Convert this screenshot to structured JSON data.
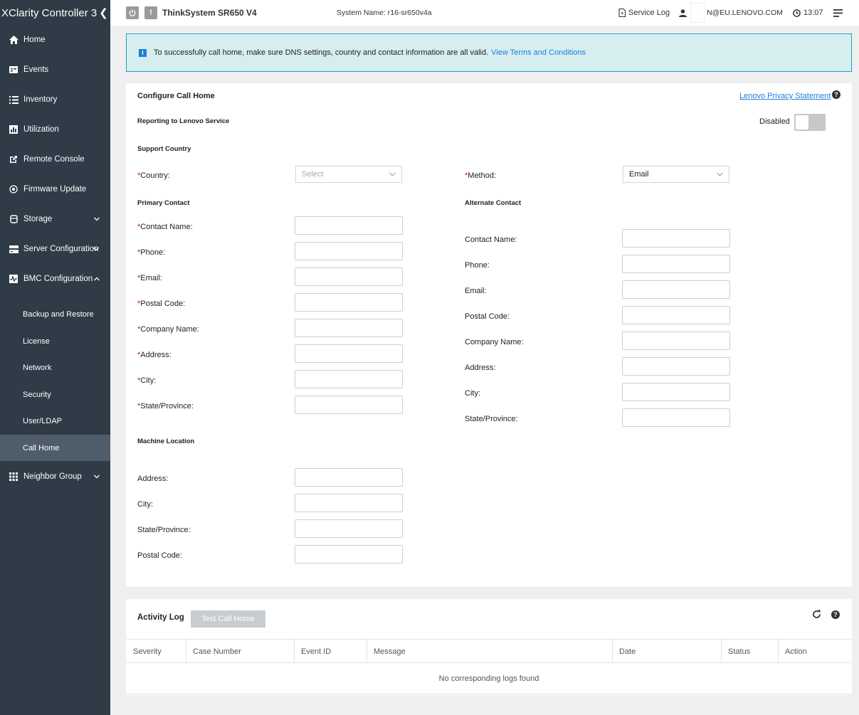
{
  "sidebar": {
    "brand": "XClarity Controller 3",
    "items": [
      {
        "label": "Home"
      },
      {
        "label": "Events"
      },
      {
        "label": "Inventory"
      },
      {
        "label": "Utilization"
      },
      {
        "label": "Remote Console"
      },
      {
        "label": "Firmware Update"
      },
      {
        "label": "Storage"
      },
      {
        "label": "Server Configuration"
      },
      {
        "label": "BMC Configuration"
      },
      {
        "label": "Neighbor Group"
      }
    ],
    "bmc_sub": [
      {
        "label": "Backup and Restore"
      },
      {
        "label": "License"
      },
      {
        "label": "Network"
      },
      {
        "label": "Security"
      },
      {
        "label": "User/LDAP"
      },
      {
        "label": "Call Home"
      }
    ]
  },
  "header": {
    "model": "ThinkSystem SR650 V4",
    "system_name": "System Name: r16-sr650v4a",
    "service_log": "Service Log",
    "user": "N@EU.LENOVO.COM",
    "time": "13:07"
  },
  "notice": {
    "text": "To successfully call home, make sure DNS settings, country and contact information are all valid.",
    "link": "View Terms and Conditions"
  },
  "config": {
    "title": "Configure Call Home",
    "privacy_link": "Lenovo Privacy Statement",
    "reporting_label": "Reporting to Lenovo Service",
    "toggle_label": "Disabled",
    "support_country": "Support Country",
    "country_label": "Country:",
    "country_placeholder": "Select",
    "method_label": "Method:",
    "method_value": "Email",
    "primary_title": "Primary Contact",
    "alternate_title": "Alternate Contact",
    "primary_fields": [
      {
        "label": "Contact Name:"
      },
      {
        "label": "Phone:"
      },
      {
        "label": "Email:"
      },
      {
        "label": "Postal Code:"
      },
      {
        "label": "Company Name:"
      },
      {
        "label": "Address:"
      },
      {
        "label": "City:"
      },
      {
        "label": "State/Province:"
      }
    ],
    "alternate_fields": [
      {
        "label": "Contact Name:"
      },
      {
        "label": "Phone:"
      },
      {
        "label": "Email:"
      },
      {
        "label": "Postal Code:"
      },
      {
        "label": "Company Name:"
      },
      {
        "label": "Address:"
      },
      {
        "label": "City:"
      },
      {
        "label": "State/Province:"
      }
    ],
    "machine_title": "Machine Location",
    "machine_fields": [
      {
        "label": "Address:"
      },
      {
        "label": "City:"
      },
      {
        "label": "State/Province:"
      },
      {
        "label": "Postal Code:"
      }
    ],
    "required_mark": "*"
  },
  "activity": {
    "title": "Activity Log",
    "test_button": "Test Call Home",
    "columns": [
      "Severity",
      "Case Number",
      "Event ID",
      "Message",
      "Date",
      "Status",
      "Action"
    ],
    "empty": "No corresponding logs found"
  },
  "colors": {
    "sidebar_bg": "#2f3b47",
    "sidebar_active": "#4f5d6a",
    "link": "#1c7fd8",
    "notice_bg": "#d7eef1",
    "required": "#c8102e"
  }
}
